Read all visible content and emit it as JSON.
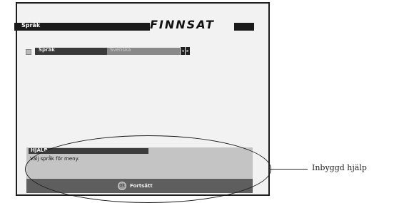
{
  "header": {
    "title": "Språk",
    "brand": "FINNSAT"
  },
  "setting_row": {
    "label": "Språk",
    "value": "Svenska",
    "prev_arrow": "◂",
    "next_arrow": "▸"
  },
  "help": {
    "title": "HJÄLP",
    "text": "Välj språk för meny."
  },
  "footer": {
    "ok_icon": "OK",
    "continue_label": "Fortsätt"
  },
  "callout": {
    "label": "Inbyggd hjälp"
  }
}
